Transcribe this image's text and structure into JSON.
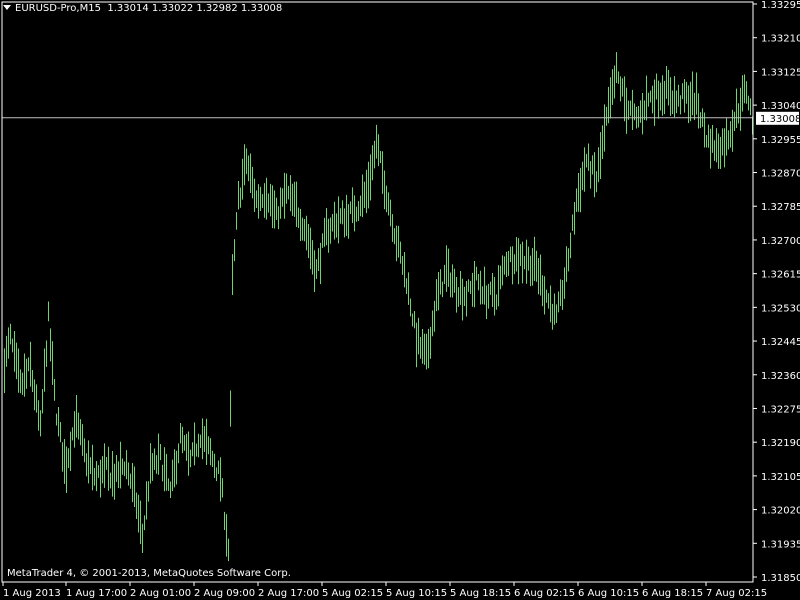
{
  "header": {
    "symbol": "EURUSD-Pro,M15",
    "ohlc": "1.33014 1.33022 1.32982 1.33008"
  },
  "footer": {
    "copyright": "MetaTrader 4, © 2001-2013, MetaQuotes Software Corp."
  },
  "colors": {
    "background": "#000000",
    "bars": "#6fd36f",
    "grid_frame": "#ffffff",
    "text": "#ffffff",
    "price_line": "#c0c0c0"
  },
  "chart_data": {
    "type": "ohlc-bar",
    "symbol": "EURUSD-Pro",
    "timeframe": "M15",
    "current_price": "1.33008",
    "y_ticks": [
      "1.33295",
      "1.33210",
      "1.33125",
      "1.33040",
      "1.32955",
      "1.32870",
      "1.32785",
      "1.32700",
      "1.32615",
      "1.32530",
      "1.32445",
      "1.32360",
      "1.32275",
      "1.32190",
      "1.32105",
      "1.32020",
      "1.31935",
      "1.31850"
    ],
    "ylim": [
      1.3185,
      1.33295
    ],
    "x_ticks": [
      "1 Aug 2013",
      "1 Aug 17:00",
      "2 Aug 01:00",
      "2 Aug 09:00",
      "2 Aug 17:00",
      "5 Aug 02:15",
      "5 Aug 10:15",
      "5 Aug 18:15",
      "6 Aug 02:15",
      "6 Aug 10:15",
      "6 Aug 18:15",
      "7 Aug 02:15"
    ],
    "grid": false,
    "price_path": [
      [
        0,
        1.3235
      ],
      [
        10,
        1.3245
      ],
      [
        20,
        1.3233
      ],
      [
        30,
        1.3238
      ],
      [
        40,
        1.3222
      ],
      [
        48,
        1.325
      ],
      [
        55,
        1.3228
      ],
      [
        65,
        1.3212
      ],
      [
        75,
        1.3225
      ],
      [
        85,
        1.3215
      ],
      [
        95,
        1.321
      ],
      [
        105,
        1.3212
      ],
      [
        115,
        1.321
      ],
      [
        125,
        1.3214
      ],
      [
        135,
        1.3205
      ],
      [
        142,
        1.3195
      ],
      [
        150,
        1.3212
      ],
      [
        160,
        1.3215
      ],
      [
        170,
        1.3206
      ],
      [
        180,
        1.322
      ],
      [
        190,
        1.3214
      ],
      [
        200,
        1.3221
      ],
      [
        210,
        1.3216
      ],
      [
        220,
        1.321
      ],
      [
        228,
        1.3192
      ],
      [
        232,
        1.326
      ],
      [
        238,
        1.328
      ],
      [
        246,
        1.329
      ],
      [
        256,
        1.328
      ],
      [
        266,
        1.3282
      ],
      [
        276,
        1.3276
      ],
      [
        286,
        1.3282
      ],
      [
        296,
        1.3278
      ],
      [
        306,
        1.3272
      ],
      [
        316,
        1.3262
      ],
      [
        326,
        1.3272
      ],
      [
        336,
        1.3275
      ],
      [
        346,
        1.3276
      ],
      [
        356,
        1.3278
      ],
      [
        366,
        1.3282
      ],
      [
        376,
        1.3294
      ],
      [
        386,
        1.3282
      ],
      [
        396,
        1.327
      ],
      [
        406,
        1.326
      ],
      [
        416,
        1.3245
      ],
      [
        426,
        1.324
      ],
      [
        436,
        1.3255
      ],
      [
        446,
        1.3262
      ],
      [
        456,
        1.3258
      ],
      [
        466,
        1.3256
      ],
      [
        476,
        1.326
      ],
      [
        486,
        1.3256
      ],
      [
        496,
        1.3256
      ],
      [
        506,
        1.3265
      ],
      [
        516,
        1.3266
      ],
      [
        526,
        1.3265
      ],
      [
        536,
        1.3263
      ],
      [
        546,
        1.3256
      ],
      [
        556,
        1.325
      ],
      [
        566,
        1.3262
      ],
      [
        576,
        1.328
      ],
      [
        586,
        1.329
      ],
      [
        596,
        1.3285
      ],
      [
        606,
        1.33
      ],
      [
        616,
        1.3312
      ],
      [
        626,
        1.3304
      ],
      [
        636,
        1.33
      ],
      [
        646,
        1.3305
      ],
      [
        656,
        1.3307
      ],
      [
        666,
        1.3308
      ],
      [
        676,
        1.3305
      ],
      [
        686,
        1.3306
      ],
      [
        696,
        1.3305
      ],
      [
        706,
        1.3296
      ],
      [
        716,
        1.3293
      ],
      [
        726,
        1.3295
      ],
      [
        736,
        1.3302
      ],
      [
        746,
        1.3308
      ],
      [
        752,
        1.33
      ]
    ]
  }
}
